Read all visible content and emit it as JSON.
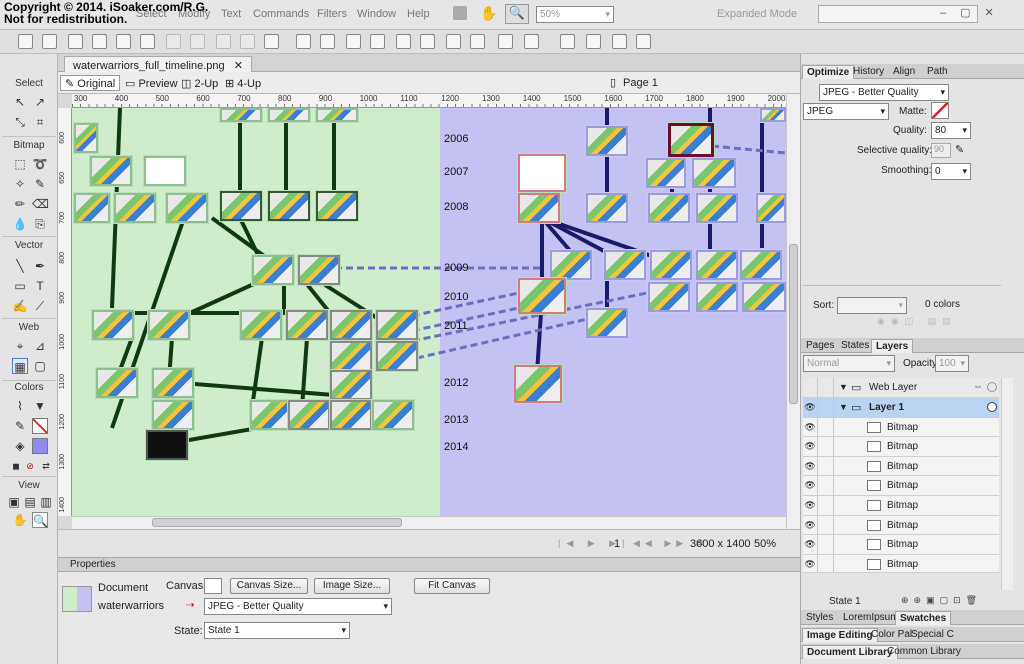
{
  "copyright": {
    "line1": "Copyright © 2014. iSoaker.com/R.G.",
    "line2": "Not for redistribution."
  },
  "menu": {
    "items": [
      "Select",
      "Modify",
      "Text",
      "Commands",
      "Filters",
      "Window",
      "Help"
    ],
    "zoom": "50%",
    "mode": "Expanded Mode"
  },
  "document": {
    "tab": "waterwarriors_full_timeline.png",
    "views": [
      "Original",
      "Preview",
      "2-Up",
      "4-Up"
    ],
    "page": "Page 1"
  },
  "ruler": {
    "top": [
      "300",
      "400",
      "500",
      "600",
      "700",
      "800",
      "900",
      "1000",
      "1100",
      "1200",
      "1300",
      "1400",
      "1500",
      "1600",
      "1700",
      "1800",
      "1900",
      "2000"
    ],
    "left": [
      "600",
      "650",
      "700",
      "800",
      "900",
      "1000",
      "1100",
      "1200",
      "1300",
      "1400"
    ]
  },
  "timeline": {
    "years": [
      "2006",
      "2007",
      "2008",
      "2009",
      "2010",
      "2011",
      "2012",
      "2013",
      "2014"
    ]
  },
  "tools": {
    "sections": [
      "Select",
      "Bitmap",
      "Vector",
      "Web",
      "Colors",
      "View"
    ]
  },
  "status": {
    "frame": "1",
    "size": "3600 x 1400",
    "zoom": "50%"
  },
  "properties": {
    "header": "Properties",
    "doc_type": "Document",
    "doc_name": "waterwarriors",
    "canvas_label": "Canvas:",
    "canvas_size_btn": "Canvas Size...",
    "image_size_btn": "Image Size...",
    "fit_canvas_btn": "Fit Canvas",
    "format": "JPEG - Better Quality",
    "state_label": "State:",
    "state_value": "State 1"
  },
  "optimize": {
    "tabs": [
      "Optimize",
      "History",
      "Align",
      "Path"
    ],
    "preset": "JPEG - Better Quality",
    "format": "JPEG",
    "matte_label": "Matte:",
    "quality_label": "Quality:",
    "quality": "80",
    "selective_label": "Selective quality:",
    "selective": "90",
    "smoothing_label": "Smoothing:",
    "smoothing": "0",
    "sort_label": "Sort:",
    "colors": "0 colors"
  },
  "layers": {
    "tabs": [
      "Pages",
      "States",
      "Layers"
    ],
    "blend": "Normal",
    "opacity_label": "Opacity",
    "opacity": "100",
    "rows": [
      {
        "name": "Web Layer",
        "type": "folder"
      },
      {
        "name": "Layer 1",
        "type": "folder"
      },
      {
        "name": "Bitmap"
      },
      {
        "name": "Bitmap"
      },
      {
        "name": "Bitmap"
      },
      {
        "name": "Bitmap"
      },
      {
        "name": "Bitmap"
      },
      {
        "name": "Bitmap"
      },
      {
        "name": "Bitmap"
      },
      {
        "name": "Bitmap"
      }
    ],
    "state": "State 1"
  },
  "bottom_tabs": {
    "row1": [
      "Styles",
      "LoremIpsum",
      "Swatches"
    ],
    "row2": [
      "Image Editing",
      "Color Pal",
      "Special C"
    ],
    "row3": [
      "Document Library",
      "Common Library"
    ]
  },
  "colors": {
    "green_zone": "#cfeccd",
    "blue_zone": "#c3c2f3",
    "accent": "#4a7fd6"
  }
}
